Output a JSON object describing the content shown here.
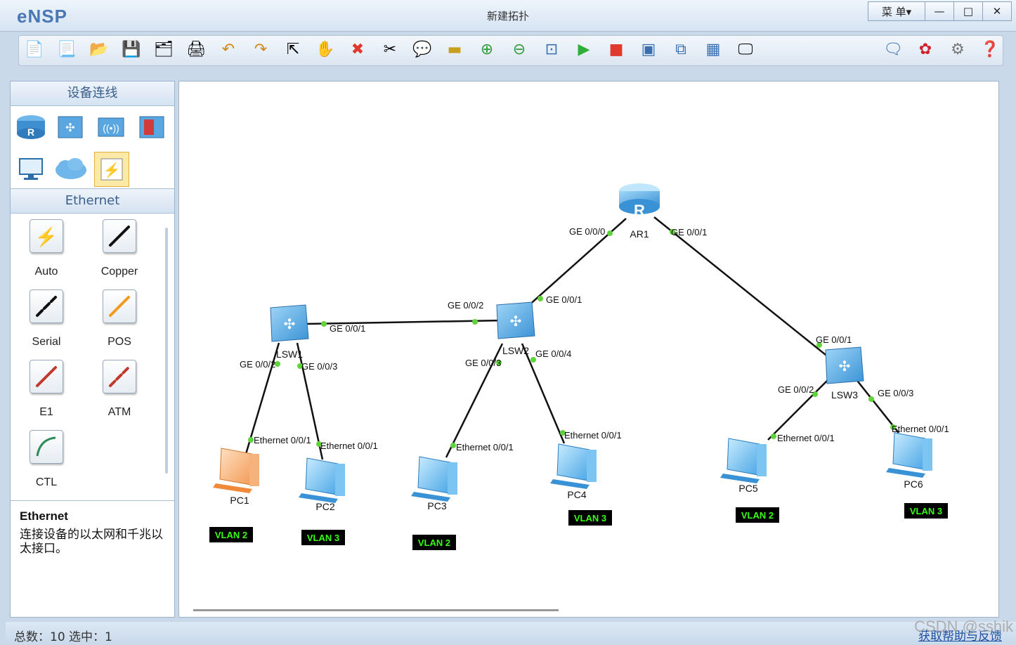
{
  "window": {
    "app_name": "eNSP",
    "title": "新建拓扑",
    "menu_label": "菜 单▾",
    "minimize": "—",
    "maximize": "□",
    "close": "✕"
  },
  "toolbar": {
    "icons": [
      "new-topology-icon",
      "new-example-icon",
      "open-icon",
      "save-icon",
      "save-as-icon",
      "print-icon",
      "undo-icon",
      "redo-icon",
      "select-icon",
      "pan-hand-icon",
      "delete-icon",
      "delete-link-icon",
      "text-label-icon",
      "rectangle-icon",
      "zoom-in-icon",
      "zoom-out-icon",
      "fit-view-icon",
      "start-device-icon",
      "stop-device-icon",
      "capture-icon",
      "topology-icon",
      "grid-icon",
      "screenshot-icon",
      "chat-icon",
      "huawei-icon",
      "settings-icon",
      "help-icon"
    ]
  },
  "left_panel": {
    "section_title": "设备连线",
    "device_icons": [
      "router-icon",
      "switch-icon",
      "wireless-icon",
      "firewall-icon",
      "pc-icon",
      "cloud-icon",
      "connection-icon"
    ],
    "cable_section_title": "Ethernet",
    "cables": [
      {
        "label": "Auto",
        "icon": "auto-cable-icon",
        "color": "#111111"
      },
      {
        "label": "Copper",
        "icon": "copper-cable-icon",
        "color": "#111111"
      },
      {
        "label": "Serial",
        "icon": "serial-cable-icon",
        "color": "#111111"
      },
      {
        "label": "POS",
        "icon": "pos-cable-icon",
        "color": "#f39a20"
      },
      {
        "label": "E1",
        "icon": "e1-cable-icon",
        "color": "#c0392b"
      },
      {
        "label": "ATM",
        "icon": "atm-cable-icon",
        "color": "#c0392b"
      },
      {
        "label": "CTL",
        "icon": "ctl-cable-icon",
        "color": "#2e8b57"
      }
    ],
    "description_title": "Ethernet",
    "description_text": "连接设备的以太网和千兆以太接口。"
  },
  "topology": {
    "devices": {
      "AR1": {
        "label": "AR1",
        "type": "router"
      },
      "LSW1": {
        "label": "LSW1",
        "type": "switch"
      },
      "LSW2": {
        "label": "LSW2",
        "type": "switch"
      },
      "LSW3": {
        "label": "LSW3",
        "type": "switch"
      },
      "PC1": {
        "label": "PC1",
        "type": "pc"
      },
      "PC2": {
        "label": "PC2",
        "type": "pc"
      },
      "PC3": {
        "label": "PC3",
        "type": "pc"
      },
      "PC4": {
        "label": "PC4",
        "type": "pc"
      },
      "PC5": {
        "label": "PC5",
        "type": "pc"
      },
      "PC6": {
        "label": "PC6",
        "type": "pc"
      }
    },
    "ports": {
      "ar1_lsw2": "GE 0/0/0",
      "ar1_lsw3": "GE 0/0/1",
      "lsw2_ar1": "GE 0/0/1",
      "lsw2_lsw1": "GE 0/0/2",
      "lsw1_lsw2": "GE 0/0/1",
      "lsw1_pc1": "GE 0/0/2",
      "lsw1_pc2": "GE 0/0/3",
      "lsw2_pc3": "GE 0/0/3",
      "lsw2_pc4": "GE 0/0/4",
      "lsw3_ar1": "GE 0/0/1",
      "lsw3_pc5": "GE 0/0/2",
      "lsw3_pc6": "GE 0/0/3",
      "pc1": "Ethernet 0/0/1",
      "pc2": "Ethernet 0/0/1",
      "pc3": "Ethernet 0/0/1",
      "pc4": "Ethernet 0/0/1",
      "pc5": "Ethernet 0/0/1",
      "pc6": "Ethernet 0/0/1"
    },
    "vlans": {
      "pc1": "VLAN 2",
      "pc2": "VLAN 3",
      "pc3": "VLAN 2",
      "pc4": "VLAN 3",
      "pc5": "VLAN 2",
      "pc6": "VLAN 3"
    },
    "colors": {
      "link": "#111111",
      "port_dot": "#5fd43a",
      "vlan_bg": "#000000",
      "vlan_text": "#39ff14"
    }
  },
  "status": {
    "summary": "总数：10  选中：1",
    "feedback_link": "获取帮助与反馈",
    "watermark": "CSDN @sshik"
  }
}
